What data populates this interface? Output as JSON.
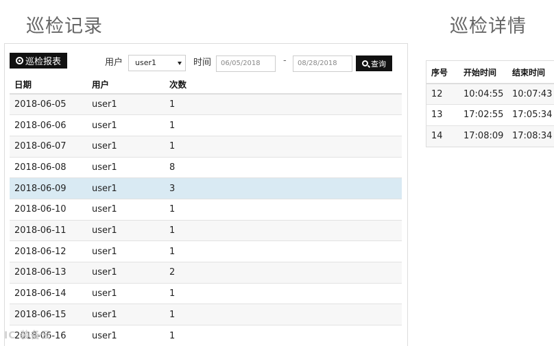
{
  "left_panel": {
    "title": "巡检记录",
    "report_button": "巡检报表",
    "user_label": "用户",
    "user_select": "user1",
    "time_label": "时间",
    "date_start": "06/05/2018",
    "date_sep": "-",
    "date_end": "08/28/2018",
    "query_button": "查询",
    "table": {
      "headers": [
        "日期",
        "用户",
        "次数"
      ],
      "rows": [
        [
          "2018-06-05",
          "user1",
          "1"
        ],
        [
          "2018-06-06",
          "user1",
          "1"
        ],
        [
          "2018-06-07",
          "user1",
          "1"
        ],
        [
          "2018-06-08",
          "user1",
          "8"
        ],
        [
          "2018-06-09",
          "user1",
          "3"
        ],
        [
          "2018-06-10",
          "user1",
          "1"
        ],
        [
          "2018-06-11",
          "user1",
          "1"
        ],
        [
          "2018-06-12",
          "user1",
          "1"
        ],
        [
          "2018-06-13",
          "user1",
          "2"
        ],
        [
          "2018-06-14",
          "user1",
          "1"
        ],
        [
          "2018-06-15",
          "user1",
          "1"
        ],
        [
          "2018-06-16",
          "user1",
          "1"
        ]
      ]
    }
  },
  "right_panel": {
    "title": "巡检详情",
    "table": {
      "headers": [
        "序号",
        "开始时间",
        "结束时间"
      ],
      "rows": [
        [
          "12",
          "10:04:55",
          "10:07:43"
        ],
        [
          "13",
          "17:02:55",
          "17:05:34"
        ],
        [
          "14",
          "17:08:09",
          "17:08:34"
        ]
      ]
    }
  },
  "watermark": "IC 装备云"
}
